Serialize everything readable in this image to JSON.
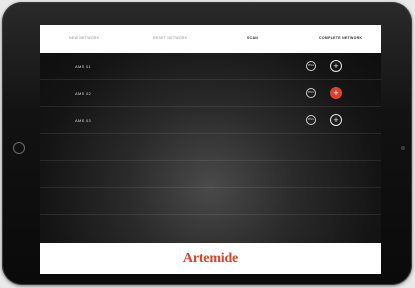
{
  "topbar": {
    "tabs": [
      {
        "label": "NEW NETWORK"
      },
      {
        "label": "RESET NETWORK"
      },
      {
        "label": "SCAN"
      },
      {
        "label": "COMPLETE NETWORK"
      }
    ]
  },
  "devices": [
    {
      "label": "AMS 01",
      "ping_label": "PING",
      "add_label": "+"
    },
    {
      "label": "AMS 02",
      "ping_label": "PING",
      "add_label": "+"
    },
    {
      "label": "AMS 03",
      "ping_label": "PING",
      "add_label": "+"
    }
  ],
  "footer": {
    "logo_text": "Artemide"
  },
  "colors": {
    "accent": "#d9402f",
    "brand": "#d44430"
  }
}
